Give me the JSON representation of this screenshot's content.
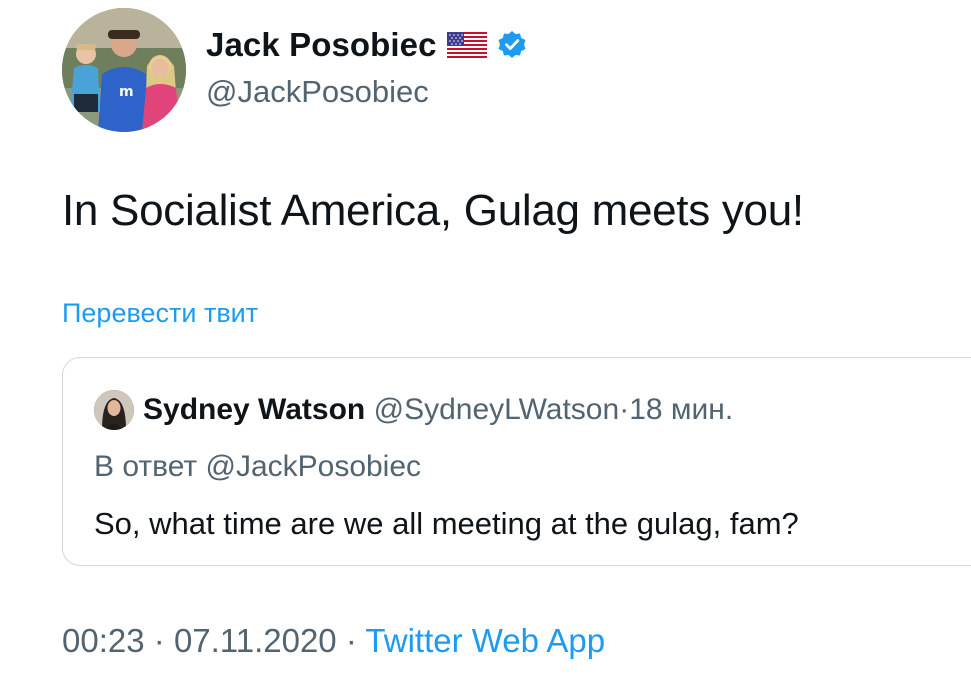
{
  "author": {
    "name": "Jack Posobiec",
    "handle": "@JackPosobiec",
    "flag_icon": "us-flag-icon",
    "verified_icon": "verified-badge-icon",
    "verified_color": "#1d9bf0"
  },
  "tweet": {
    "text": "In Socialist America, Gulag meets you!",
    "translate_label": "Перевести твит"
  },
  "quoted_tweet": {
    "name": "Sydney Watson",
    "handle": "@SydneyLWatson",
    "separator": "·",
    "time": "18 мин.",
    "reply_prefix": "В ответ",
    "reply_mention": "@JackPosobiec",
    "text": "So, what time are we all meeting at the gulag, fam?"
  },
  "meta": {
    "time": "00:23",
    "separator": "·",
    "date": "07.11.2020",
    "source": "Twitter Web App"
  },
  "colors": {
    "link": "#1d9bf0",
    "secondary_text": "#536471",
    "primary_text": "#0f1419",
    "border": "#cfd9de"
  }
}
